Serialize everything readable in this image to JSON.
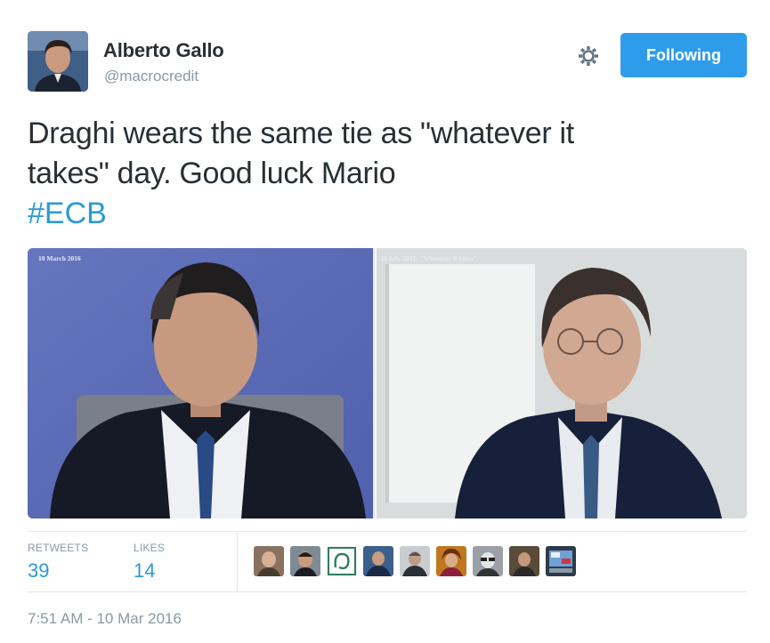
{
  "author": {
    "name": "Alberto Gallo",
    "handle": "@macrocredit"
  },
  "follow_button": {
    "label": "Following"
  },
  "settings_icon": "gear-icon",
  "tweet": {
    "text_line1": "Draghi wears the same tie as \"whatever it",
    "text_line2": "takes\" day. Good luck Mario",
    "hashtag": "#ECB"
  },
  "media": {
    "left_caption": "10 March 2016",
    "right_caption": "26 July 2012: \"Whatever it takes\""
  },
  "stats": {
    "retweets_label": "RETWEETS",
    "retweets_value": "39",
    "likes_label": "LIKES",
    "likes_value": "14"
  },
  "timestamp": "7:51 AM - 10 Mar 2016",
  "colors": {
    "accent": "#2b9ad5",
    "button": "#2f9ceb",
    "muted": "#8899a6",
    "text": "#292f33"
  }
}
